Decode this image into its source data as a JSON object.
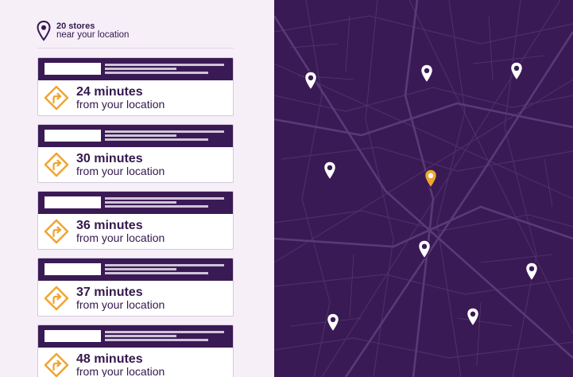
{
  "header": {
    "store_count": "20 stores",
    "subtitle": "near your location",
    "icon": "location-pin-icon"
  },
  "stores": [
    {
      "minutes": "24 minutes",
      "from": "from your location",
      "icon": "directions-icon"
    },
    {
      "minutes": "30 minutes",
      "from": "from your location",
      "icon": "directions-icon"
    },
    {
      "minutes": "36 minutes",
      "from": "from your location",
      "icon": "directions-icon"
    },
    {
      "minutes": "37 minutes",
      "from": "from your location",
      "icon": "directions-icon"
    },
    {
      "minutes": "48 minutes",
      "from": "from your location",
      "icon": "directions-icon"
    }
  ],
  "map": {
    "background_color": "#3a1a54",
    "street_color": "#5a3a76",
    "marker_color": "#ffffff",
    "selected_marker_color": "#f0a530",
    "marker_count": 10,
    "selected_marker_count": 1
  },
  "colors": {
    "sidebar_bg": "#f6eff8",
    "card_header": "#3a1a54",
    "text": "#34184d",
    "accent": "#f0a530"
  }
}
